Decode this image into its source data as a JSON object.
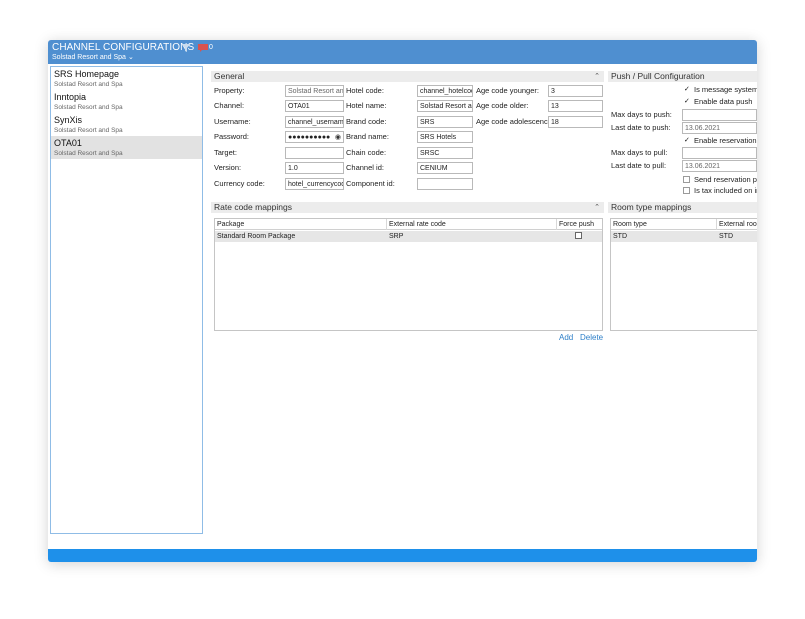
{
  "header": {
    "title": "CHANNEL CONFIGURATIONS",
    "subtitle": "Solstad Resort and Spa",
    "message_count": "0"
  },
  "sidebar": {
    "items": [
      {
        "name": "SRS Homepage",
        "sub": "Solstad Resort and Spa"
      },
      {
        "name": "Inntopia",
        "sub": "Solstad Resort and Spa"
      },
      {
        "name": "SynXis",
        "sub": "Solstad Resort and Spa"
      },
      {
        "name": "OTA01",
        "sub": "Solstad Resort and Spa",
        "selected": true
      }
    ]
  },
  "general": {
    "title": "General",
    "property_label": "Property:",
    "property_value": "Solstad Resort and Spa",
    "channel_label": "Channel:",
    "channel_value": "OTA01",
    "username_label": "Username:",
    "username_value": "channel_username",
    "password_label": "Password:",
    "password_value": "●●●●●●●●●●",
    "target_label": "Target:",
    "target_value": "",
    "version_label": "Version:",
    "version_value": "1.0",
    "currency_label": "Currency code:",
    "currency_value": "hotel_currencycode",
    "hotel_code_label": "Hotel code:",
    "hotel_code_value": "channel_hotelcode",
    "hotel_name_label": "Hotel name:",
    "hotel_name_value": "Solstad Resort and Spa",
    "brand_code_label": "Brand code:",
    "brand_code_value": "SRS",
    "brand_name_label": "Brand name:",
    "brand_name_value": "SRS Hotels",
    "chain_code_label": "Chain code:",
    "chain_code_value": "SRSC",
    "channel_id_label": "Channel id:",
    "channel_id_value": "CENIUM",
    "component_id_label": "Component id:",
    "component_id_value": "",
    "age_younger_label": "Age code younger:",
    "age_younger_value": "3",
    "age_older_label": "Age code older:",
    "age_older_value": "13",
    "age_adolescence_label": "Age code adolescence:",
    "age_adolescence_value": "18"
  },
  "pushpull": {
    "title": "Push / Pull Configuration",
    "is_message_system_label": "Is message system av",
    "is_message_system_checked": true,
    "enable_data_push_label": "Enable data push",
    "enable_data_push_checked": true,
    "max_days_push_label": "Max days to push:",
    "max_days_push_value": "",
    "last_date_push_label": "Last date to push:",
    "last_date_push_value": "13.06.2021",
    "enable_reservation_pull_label": "Enable reservation pu",
    "enable_reservation_pull_checked": true,
    "max_days_pull_label": "Max days to pull:",
    "max_days_pull_value": "",
    "last_date_pull_label": "Last date to pull:",
    "last_date_pull_value": "13.06.2021",
    "send_reservation_pull_label": "Send reservation pull",
    "send_reservation_pull_checked": false,
    "tax_included_label": "Is tax included on inc",
    "tax_included_checked": false
  },
  "rate_code": {
    "title": "Rate code mappings",
    "col_package": "Package",
    "col_external": "External rate code",
    "col_force": "Force push",
    "rows": [
      {
        "package": "Standard Room Package",
        "external": "SRP",
        "force": false
      }
    ],
    "add_label": "Add",
    "delete_label": "Delete"
  },
  "room_type": {
    "title": "Room type mappings",
    "col_room": "Room type",
    "col_external": "External roo",
    "rows": [
      {
        "room": "STD",
        "external": "STD"
      }
    ]
  }
}
